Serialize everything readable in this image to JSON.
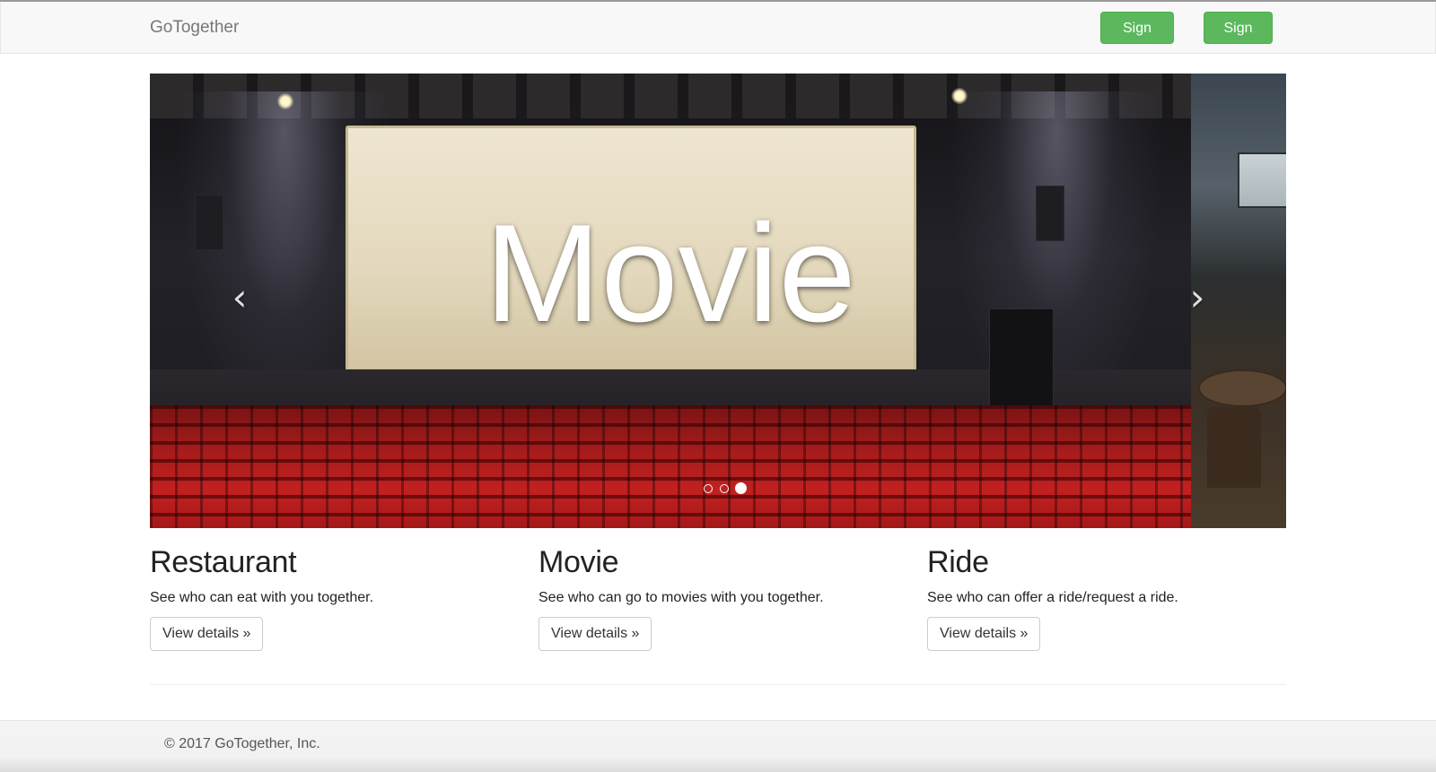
{
  "navbar": {
    "brand": "GoTogether",
    "signup_label": "Sign up",
    "signin_label": "Sign in",
    "button_color": "#5cb85c"
  },
  "carousel": {
    "caption": "Movie",
    "prev_icon": "chevron-left-icon",
    "next_icon": "chevron-right-icon",
    "prev_glyph": "‹",
    "next_glyph": "›",
    "slide_count": 3,
    "active_index": 2
  },
  "features": [
    {
      "title": "Restaurant",
      "text": "See who can eat with you together.",
      "button": "View details »"
    },
    {
      "title": "Movie",
      "text": "See who can go to movies with you together.",
      "button": "View details »"
    },
    {
      "title": "Ride",
      "text": "See who can offer a ride/request a ride.",
      "button": "View details »"
    }
  ],
  "footer": {
    "copyright": "© 2017 GoTogether, Inc."
  }
}
